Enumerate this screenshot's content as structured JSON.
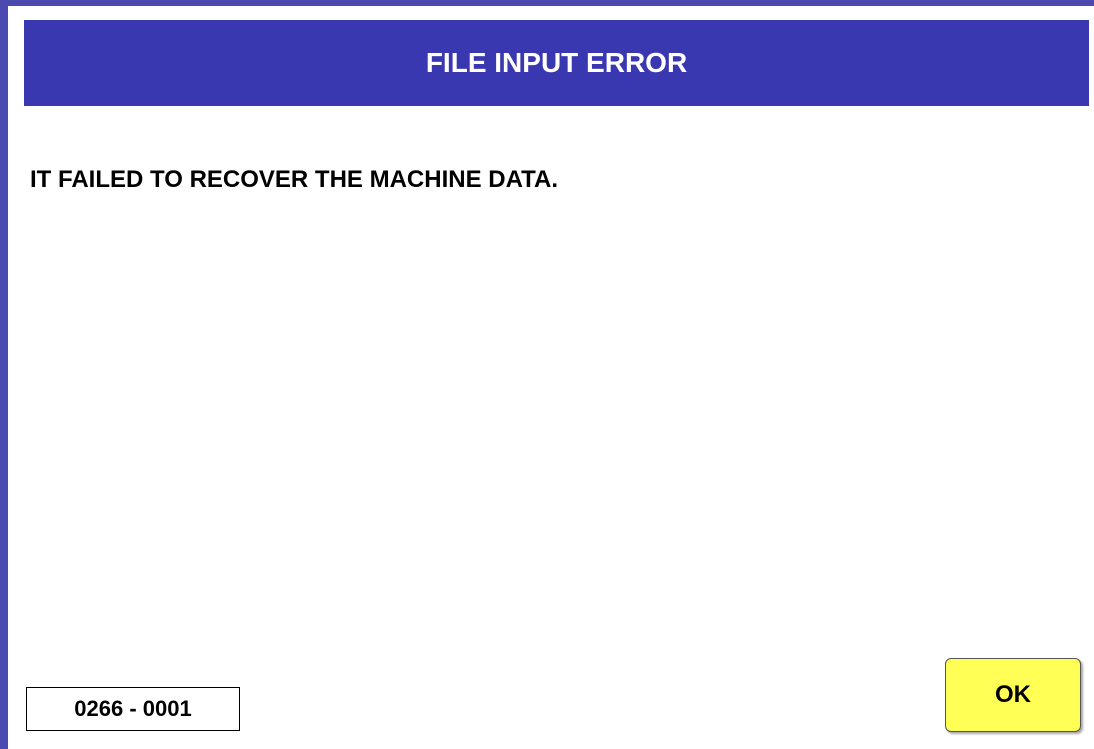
{
  "dialog": {
    "title": "FILE INPUT ERROR",
    "message": "IT FAILED TO RECOVER THE MACHINE DATA.",
    "error_code": "0266 - 0001",
    "ok_label": "OK"
  },
  "colors": {
    "title_bar": "#3a38b0",
    "ok_button": "#ffff55",
    "border": "#4a4ab0"
  }
}
